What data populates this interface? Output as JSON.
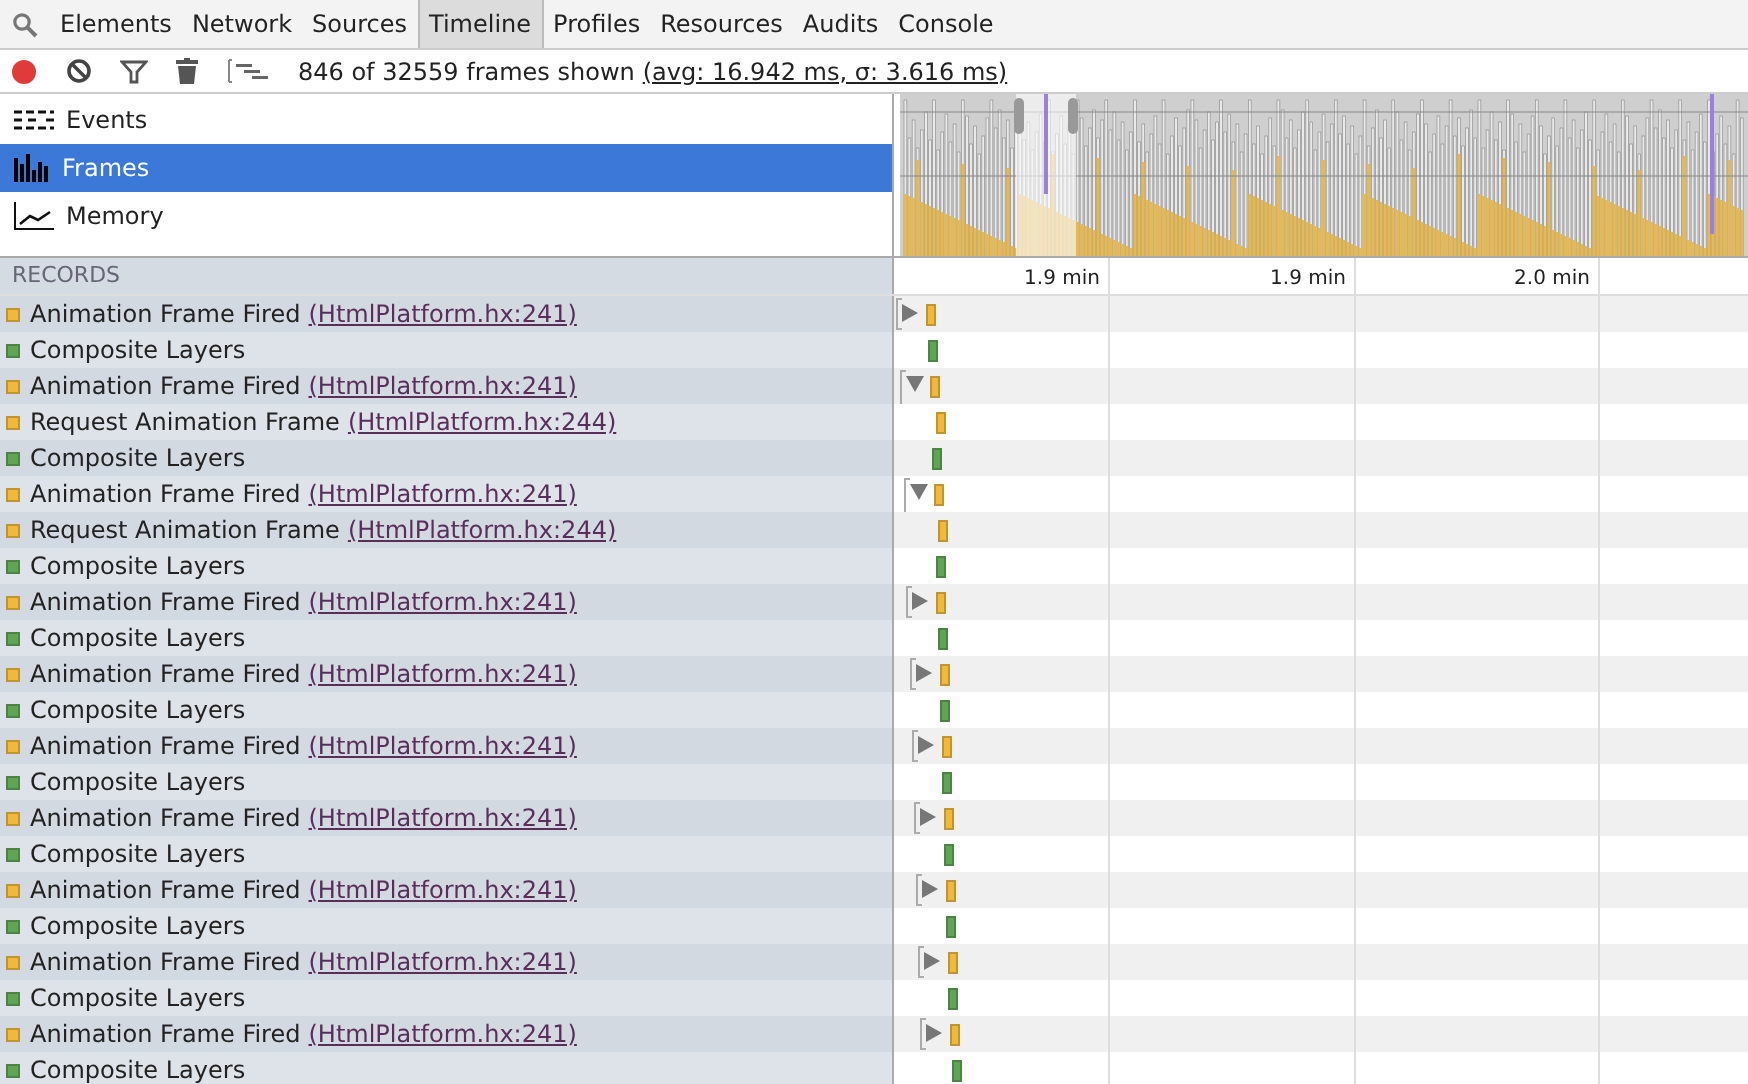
{
  "tabs": [
    {
      "label": "Elements",
      "selected": false
    },
    {
      "label": "Network",
      "selected": false
    },
    {
      "label": "Sources",
      "selected": false
    },
    {
      "label": "Timeline",
      "selected": true
    },
    {
      "label": "Profiles",
      "selected": false
    },
    {
      "label": "Resources",
      "selected": false
    },
    {
      "label": "Audits",
      "selected": false
    },
    {
      "label": "Console",
      "selected": false
    }
  ],
  "toolbar": {
    "summary": "846 of 32559 frames shown",
    "stats_link": "(avg: 16.942 ms, σ: 3.616 ms)"
  },
  "modes": [
    {
      "label": "Events",
      "kind": "events",
      "selected": false
    },
    {
      "label": "Frames",
      "kind": "frames",
      "selected": true
    },
    {
      "label": "Memory",
      "kind": "memory",
      "selected": false
    }
  ],
  "records_header": "RECORDS",
  "ruler": [
    "1.9 min",
    "1.9 min",
    "2.0 min"
  ],
  "records": [
    {
      "title": "Animation Frame Fired",
      "link": "(HtmlPlatform.hx:241)",
      "color": "#f0b93a",
      "expanded": false
    },
    {
      "title": "Composite Layers",
      "color": "#5fa555"
    },
    {
      "title": "Animation Frame Fired",
      "link": "(HtmlPlatform.hx:241)",
      "color": "#f0b93a",
      "expanded": true,
      "children": [
        {
          "title": "Request Animation Frame",
          "link": "(HtmlPlatform.hx:244)",
          "color": "#f0b93a"
        }
      ]
    },
    {
      "title": "Composite Layers",
      "color": "#5fa555"
    },
    {
      "title": "Animation Frame Fired",
      "link": "(HtmlPlatform.hx:241)",
      "color": "#f0b93a",
      "expanded": true,
      "children": [
        {
          "title": "Request Animation Frame",
          "link": "(HtmlPlatform.hx:244)",
          "color": "#f0b93a"
        }
      ]
    },
    {
      "title": "Composite Layers",
      "color": "#5fa555"
    },
    {
      "title": "Animation Frame Fired",
      "link": "(HtmlPlatform.hx:241)",
      "color": "#f0b93a",
      "expanded": false
    },
    {
      "title": "Composite Layers",
      "color": "#5fa555"
    },
    {
      "title": "Animation Frame Fired",
      "link": "(HtmlPlatform.hx:241)",
      "color": "#f0b93a",
      "expanded": false
    },
    {
      "title": "Composite Layers",
      "color": "#5fa555"
    },
    {
      "title": "Animation Frame Fired",
      "link": "(HtmlPlatform.hx:241)",
      "color": "#f0b93a",
      "expanded": false
    },
    {
      "title": "Composite Layers",
      "color": "#5fa555"
    },
    {
      "title": "Animation Frame Fired",
      "link": "(HtmlPlatform.hx:241)",
      "color": "#f0b93a",
      "expanded": false
    },
    {
      "title": "Composite Layers",
      "color": "#5fa555"
    },
    {
      "title": "Animation Frame Fired",
      "link": "(HtmlPlatform.hx:241)",
      "color": "#f0b93a",
      "expanded": false
    },
    {
      "title": "Composite Layers",
      "color": "#5fa555"
    },
    {
      "title": "Animation Frame Fired",
      "link": "(HtmlPlatform.hx:241)",
      "color": "#f0b93a",
      "expanded": false
    },
    {
      "title": "Composite Layers",
      "color": "#5fa555"
    },
    {
      "title": "Animation Frame Fired",
      "link": "(HtmlPlatform.hx:241)",
      "color": "#f0b93a",
      "expanded": false
    },
    {
      "title": "Composite Layers",
      "color": "#5fa555"
    }
  ]
}
